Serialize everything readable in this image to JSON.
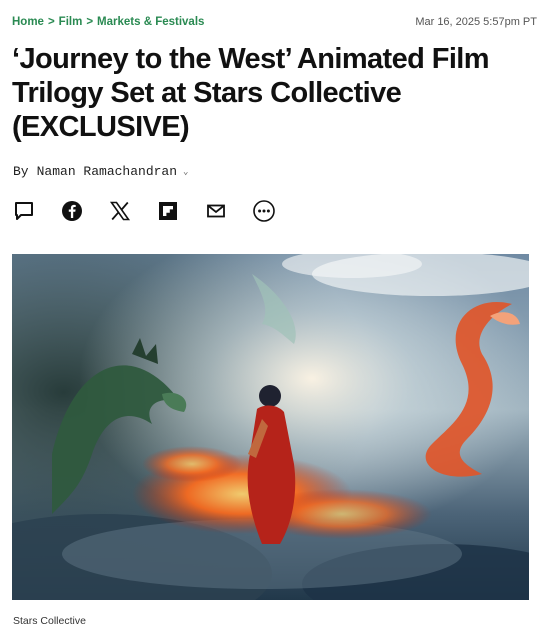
{
  "breadcrumb": {
    "items": [
      "Home",
      "Film",
      "Markets & Festivals"
    ],
    "separator": ">"
  },
  "timestamp": "Mar 16, 2025 5:57pm PT",
  "article": {
    "title_line1": "‘Journey to the West’ Animated Film",
    "title_line2": "Trilogy Set at Stars Collective",
    "title_line3": "(EXCLUSIVE)",
    "by_label": "By",
    "author": "Naman Ramachandran",
    "author_caret": "⌄"
  },
  "share_icons": [
    "comment-icon",
    "facebook-icon",
    "x-icon",
    "flipboard-icon",
    "email-icon",
    "more-icon"
  ],
  "image_caption": "Stars Collective",
  "colors": {
    "breadcrumb_green": "#2a8a52",
    "text_dark": "#111111"
  }
}
